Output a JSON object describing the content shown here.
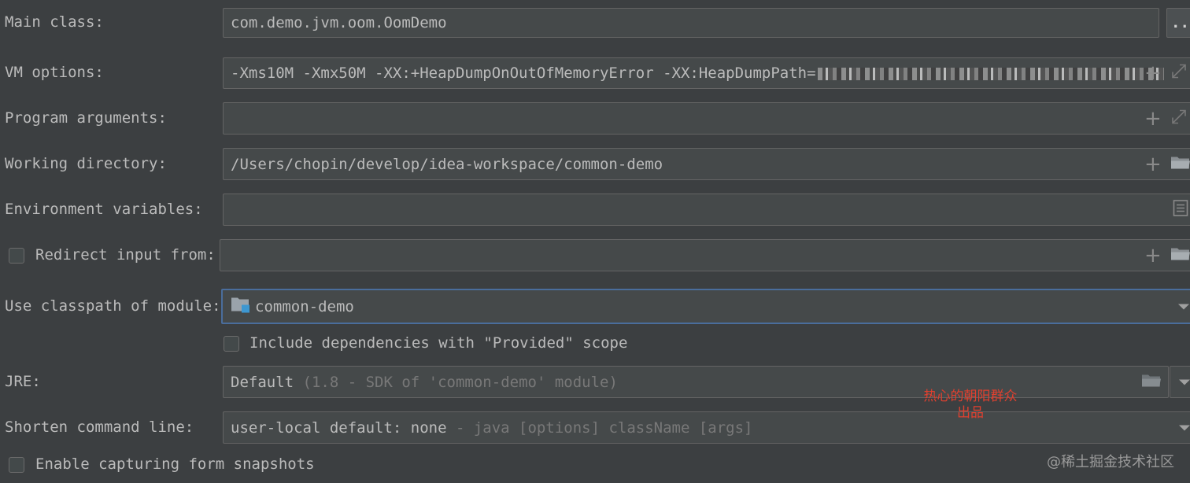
{
  "labels": {
    "main_class": "Main class:",
    "vm_options": "VM options:",
    "program_arguments": "Program arguments:",
    "working_directory": "Working directory:",
    "environment_variables": "Environment variables:",
    "redirect_input": "Redirect input from:",
    "use_classpath": "Use classpath of module:",
    "include_provided": "Include dependencies with \"Provided\" scope",
    "jre": "JRE:",
    "shorten_command_line": "Shorten command line:",
    "enable_snapshots": "Enable capturing form snapshots"
  },
  "values": {
    "main_class": "com.demo.jvm.oom.OomDemo",
    "vm_options": "-Xms10M -Xmx50M -XX:+HeapDumpOnOutOfMemoryError -XX:HeapDumpPath=",
    "program_arguments": "",
    "working_directory": "/Users/chopin/develop/idea-workspace/common-demo",
    "environment_variables": "",
    "redirect_input": "",
    "classpath_module": "common-demo",
    "jre_main": "Default",
    "jre_hint": "(1.8 - SDK of 'common-demo' module)",
    "shorten_main": "user-local default: none",
    "shorten_hint": " - java [options] className [args]"
  },
  "checkboxes": {
    "redirect_input": false,
    "include_provided": false,
    "enable_snapshots": false
  },
  "buttons": {
    "browse_ellipsis": "..."
  },
  "watermarks": {
    "red_line1": "热心的朝阳群众",
    "red_line2": "出品",
    "site": "@稀土掘金技术社区"
  },
  "icons": {
    "expand": "expand-icon",
    "add": "plus-icon",
    "folder": "folder-icon",
    "list": "list-icon",
    "module": "module-folder-icon"
  },
  "colors": {
    "background": "#3c3f41",
    "field": "#45494a",
    "focus_border": "#4a6d9c",
    "watermark_red": "#e0402f"
  }
}
